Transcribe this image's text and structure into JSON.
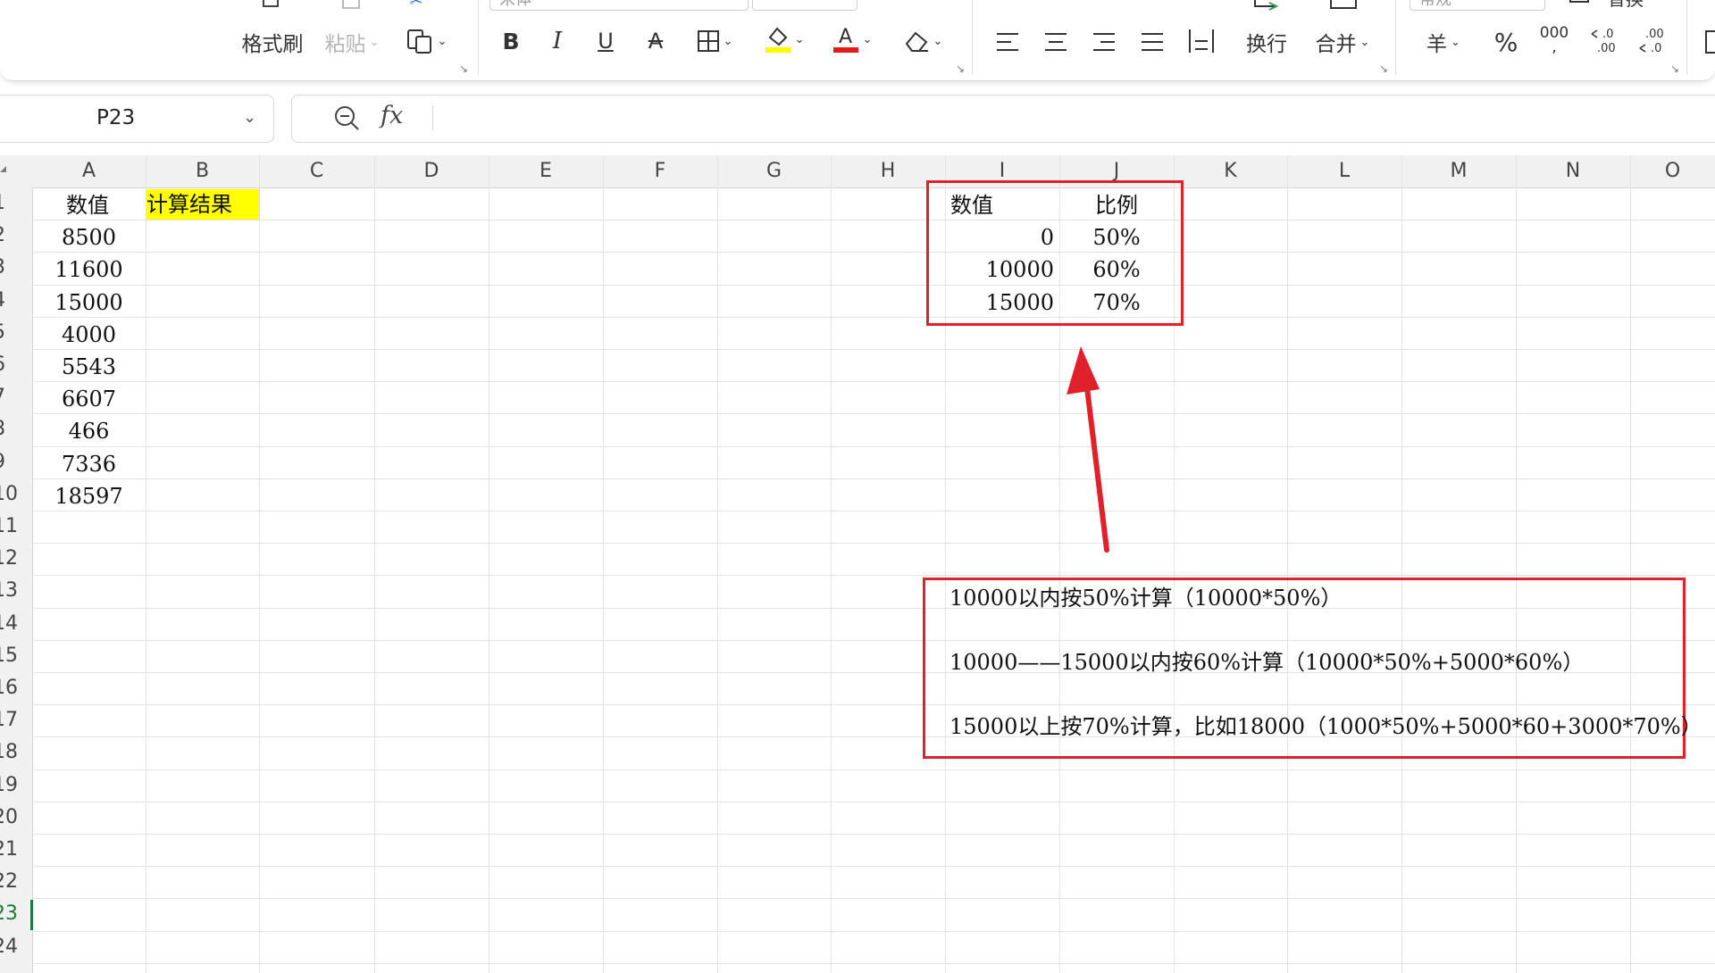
{
  "ribbon": {
    "format_painter_label": "格式刷",
    "paste_label": "粘贴",
    "font_name": "宋体",
    "wrap_label": "换行",
    "merge_label": "合并",
    "number_format": "常规",
    "replace_label": "替换",
    "percent_glyph": "%",
    "thousands_glyph": "000",
    "currency_glyph": "羊",
    "font_color": "#e01b1b",
    "fill_color": "#ffff00"
  },
  "formula_bar": {
    "cell_ref": "P23",
    "fx_label": "fx",
    "value": ""
  },
  "columns": [
    "A",
    "B",
    "C",
    "D",
    "E",
    "F",
    "G",
    "H",
    "I",
    "J",
    "K",
    "L",
    "M",
    "N",
    "O"
  ],
  "rows": [
    "1",
    "2",
    "3",
    "4",
    "5",
    "6",
    "7",
    "8",
    "9",
    "10",
    "11",
    "12",
    "13",
    "14",
    "15",
    "16",
    "17",
    "18",
    "19",
    "20",
    "21",
    "22",
    "23",
    "24"
  ],
  "active_row": "23",
  "sheet": {
    "col_a_header": "数值",
    "col_b_header": "计算结果",
    "values": [
      "8500",
      "11600",
      "15000",
      "4000",
      "5543",
      "6607",
      "466",
      "7336",
      "18597"
    ],
    "rate_table": {
      "header_value": "数值",
      "header_rate": "比例",
      "rows": [
        {
          "value": "0",
          "rate": "50%"
        },
        {
          "value": "10000",
          "rate": "60%"
        },
        {
          "value": "15000",
          "rate": "70%"
        }
      ]
    }
  },
  "notes": [
    "10000以内按50%计算（10000*50%）",
    "10000——15000以内按60%计算（10000*50%+5000*60%）",
    "15000以上按70%计算，比如18000（1000*50%+5000*60+3000*70%）"
  ],
  "colors": {
    "highlight": "#ffff00",
    "annotation_red": "#e0202a",
    "active_green": "#1f7a3a"
  }
}
